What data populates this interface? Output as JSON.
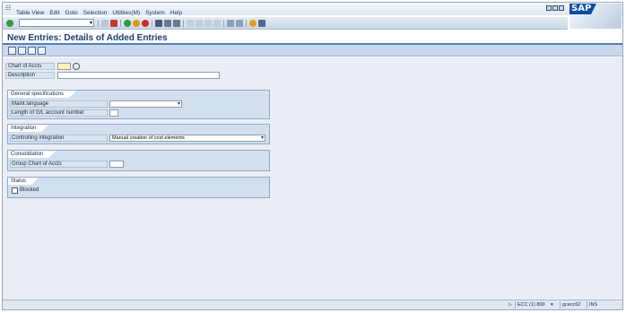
{
  "menu": [
    "Table View",
    "Edit",
    "Goto",
    "Selection",
    "Utilities(M)",
    "System",
    "Help"
  ],
  "logo": "SAP",
  "title": "New Entries: Details of Added Entries",
  "fields": {
    "chart_of_accts": {
      "label": "Chart of Accts",
      "value": ""
    },
    "description": {
      "label": "Description",
      "value": ""
    }
  },
  "groups": {
    "general": {
      "title": "General specifications",
      "maint_language": {
        "label": "Maint.language",
        "value": ""
      },
      "gl_length": {
        "label": "Length of G/L account number",
        "value": ""
      }
    },
    "integration": {
      "title": "Integration",
      "controlling": {
        "label": "Controlling integration",
        "value": "Manual creation of cost elements"
      }
    },
    "consolidation": {
      "title": "Consolidation",
      "group_chart": {
        "label": "Group Chart of Accts",
        "value": ""
      }
    },
    "status": {
      "title": "Status",
      "blocked": {
        "label": "Blocked",
        "checked": false
      }
    }
  },
  "statusbar": {
    "system": "ECC (1) 800",
    "server": "gcecc62",
    "mode": "INS"
  },
  "colors": {
    "title": "#1d3c70",
    "accent": "#4f7fbf",
    "required": "#fff3b8"
  }
}
